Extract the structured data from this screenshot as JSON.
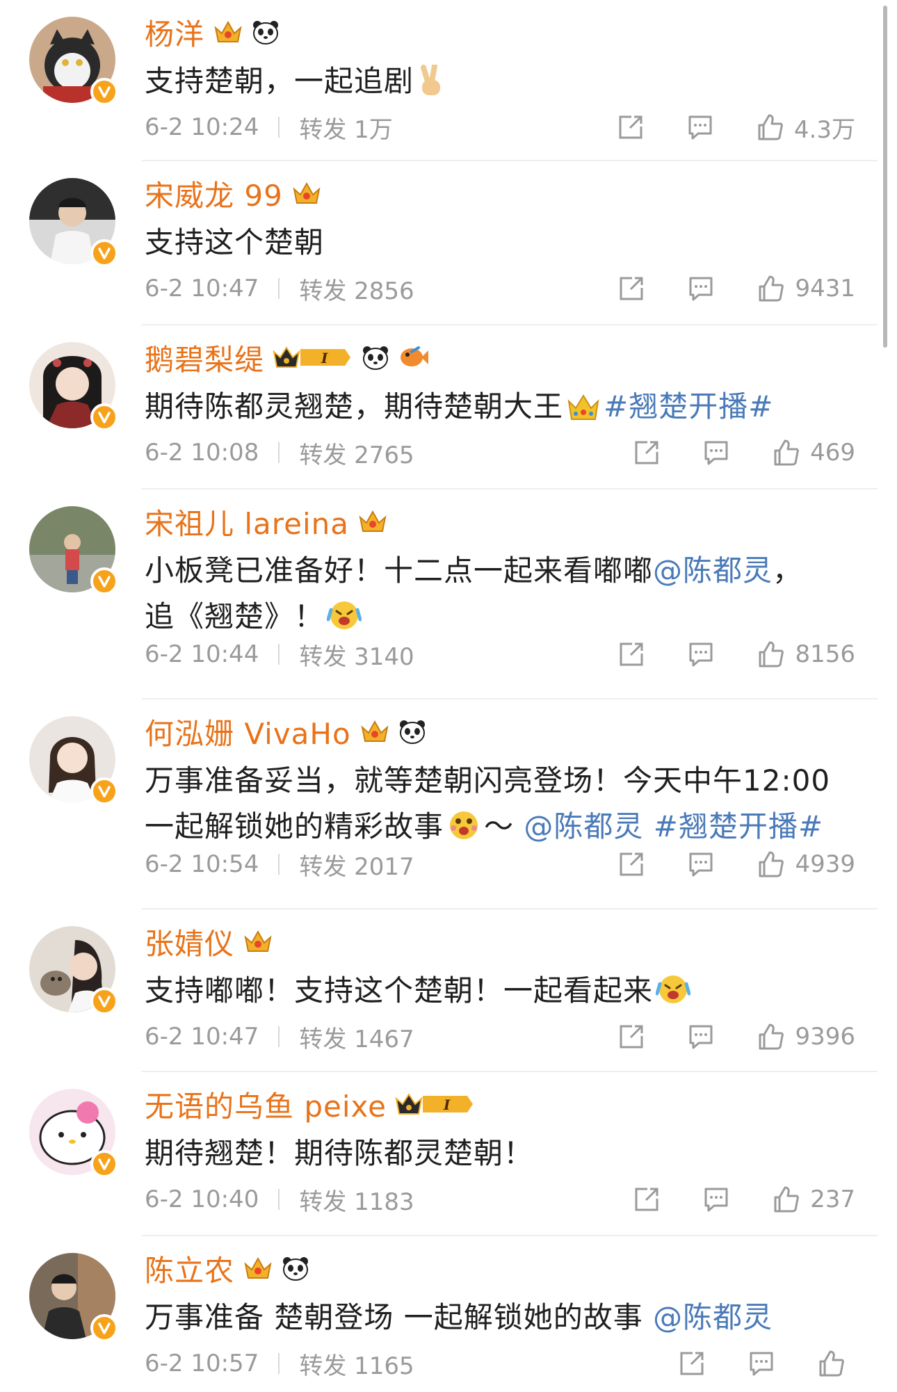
{
  "comments": [
    {
      "name": "杨洋",
      "text": "支持楚朝，一起追剧",
      "date": "6-2 10:24",
      "repost": "转发 1万",
      "likes": "4.3万",
      "avatar_color": "#c9a98a"
    },
    {
      "name": "宋威龙 99",
      "text": "支持这个楚朝",
      "date": "6-2 10:47",
      "repost": "转发 2856",
      "likes": "9431",
      "avatar_color": "#2f2f2f"
    },
    {
      "name": "鹅碧梨缇",
      "text": "期待陈都灵翘楚，期待楚朝大王",
      "tag": "#翘楚开播#",
      "date": "6-2 10:08",
      "repost": "转发 2765",
      "likes": "469",
      "avatar_color": "#7a3a3a"
    },
    {
      "name": "宋祖儿 lareina",
      "text_line1": "小板凳已准备好！十二点一起来看嘟嘟",
      "mention": "@陈都灵",
      "text_line1_end": "，",
      "text_line2": "追《翘楚》！",
      "date": "6-2 10:44",
      "repost": "转发 3140",
      "likes": "8156",
      "avatar_color": "#6d7b5a"
    },
    {
      "name": "何泓姗 VivaHo",
      "text_line1": "万事准备妥当，就等楚朝闪亮登场！今天中午12:00",
      "text_line2": "一起解锁她的精彩故事",
      "tilde": "～",
      "mention": "@陈都灵",
      "tag": "#翘楚开播#",
      "date": "6-2 10:54",
      "repost": "转发 2017",
      "likes": "4939",
      "avatar_color": "#e9e2de"
    },
    {
      "name": "张婧仪",
      "text": "支持嘟嘟！支持这个楚朝！一起看起来",
      "date": "6-2 10:47",
      "repost": "转发 1467",
      "likes": "9396",
      "avatar_color": "#d8cfc4"
    },
    {
      "name": "无语的乌鱼 peixe",
      "text": "期待翘楚！期待陈都灵楚朝！",
      "date": "6-2 10:40",
      "repost": "转发 1183",
      "likes": "237",
      "avatar_color": "#f3d6e4"
    },
    {
      "name": "陈立农",
      "text": "万事准备 楚朝登场 一起解锁她的故事",
      "mention": "@陈都灵",
      "date": "6-2 10:57",
      "repost": "转发 1165",
      "likes": "",
      "avatar_color": "#4a4a4a"
    }
  ],
  "colors": {
    "name": "#e8731a",
    "link": "#4a7ab8",
    "meta": "#9a9a9a",
    "verified": "#f7a21b"
  }
}
